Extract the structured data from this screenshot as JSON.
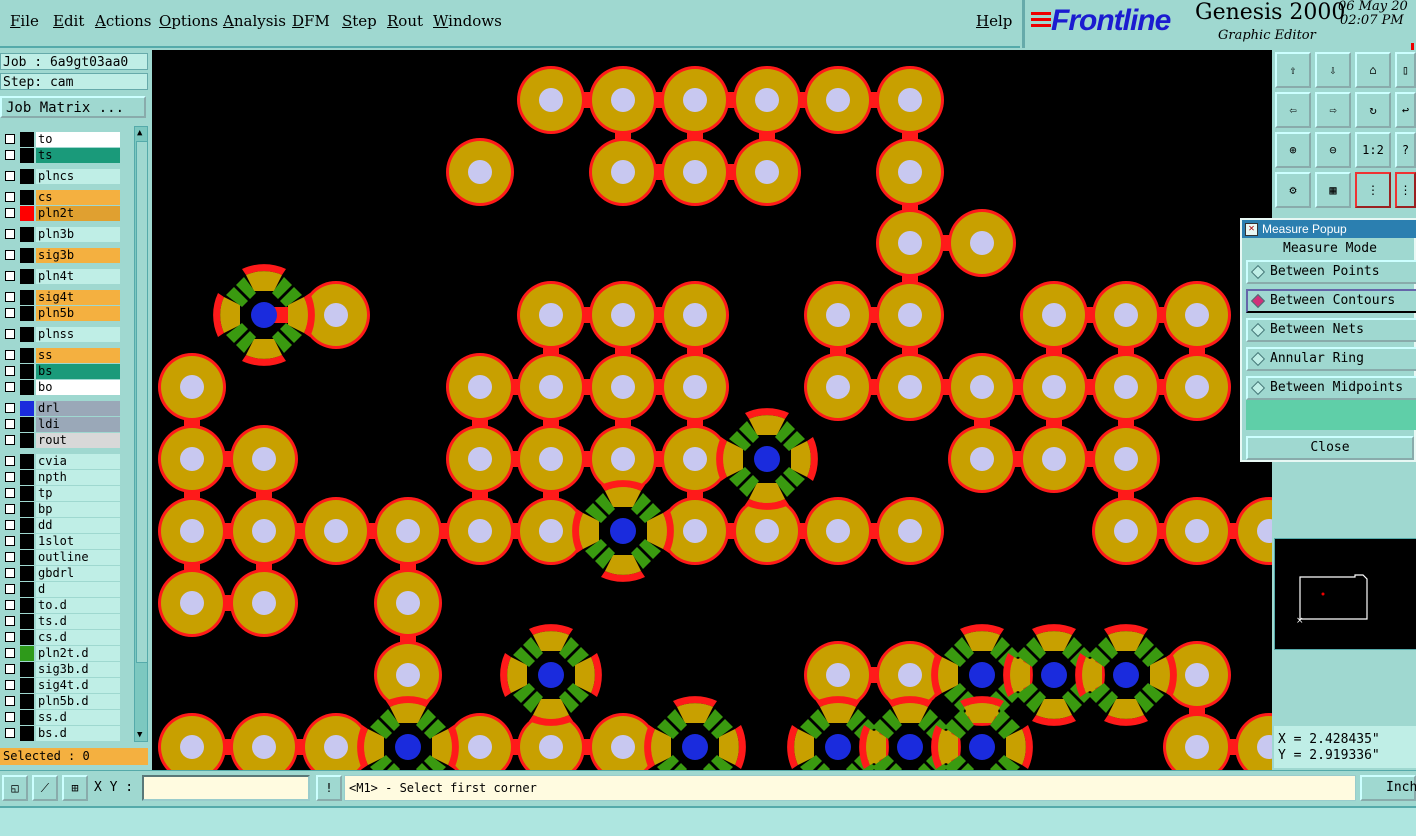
{
  "menu": {
    "items": [
      "File",
      "Edit",
      "Actions",
      "Options",
      "Analysis",
      "DFM",
      "Step",
      "Rout",
      "Windows"
    ],
    "help": "Help"
  },
  "brand": {
    "logo": "Frontline",
    "product": "Genesis 2000",
    "subtitle": "Graphic Editor",
    "date": "06 May 20",
    "time": "02:07 PM"
  },
  "left": {
    "job": "Job : 6a9gt03aa0",
    "step": "Step: cam",
    "job_matrix": "Job Matrix ...",
    "selected": "Selected : 0"
  },
  "layers": [
    {
      "name": "to",
      "bg": "#ffffff",
      "swatch": "#000000"
    },
    {
      "name": "ts",
      "bg": "#1a9a7a",
      "swatch": "#000000"
    },
    {
      "name": "plncs",
      "bg": "#bfeee6",
      "swatch": "#000000"
    },
    {
      "name": "cs",
      "bg": "#f4b040",
      "swatch": "#000000"
    },
    {
      "name": "pln2t",
      "bg": "#e0a030",
      "swatch": "#ff0000"
    },
    {
      "name": "pln3b",
      "bg": "#bfeee6",
      "swatch": "#000000"
    },
    {
      "name": "sig3b",
      "bg": "#f4b040",
      "swatch": "#000000"
    },
    {
      "name": "pln4t",
      "bg": "#bfeee6",
      "swatch": "#000000"
    },
    {
      "name": "sig4t",
      "bg": "#f4b040",
      "swatch": "#000000"
    },
    {
      "name": "pln5b",
      "bg": "#f4b040",
      "swatch": "#000000"
    },
    {
      "name": "plnss",
      "bg": "#bfeee6",
      "swatch": "#000000"
    },
    {
      "name": "ss",
      "bg": "#f4b040",
      "swatch": "#000000"
    },
    {
      "name": "bs",
      "bg": "#1a9a7a",
      "swatch": "#000000"
    },
    {
      "name": "bo",
      "bg": "#ffffff",
      "swatch": "#000000"
    },
    {
      "name": "drl",
      "bg": "#9aa8b8",
      "swatch": "#1a2bdd"
    },
    {
      "name": "ldi",
      "bg": "#9aa8b8",
      "swatch": "#000000"
    },
    {
      "name": "rout",
      "bg": "#d8d8d8",
      "swatch": "#000000"
    },
    {
      "name": "cvia",
      "bg": "#bfeee6",
      "swatch": "#000000"
    },
    {
      "name": "npth",
      "bg": "#bfeee6",
      "swatch": "#000000"
    },
    {
      "name": "tp",
      "bg": "#bfeee6",
      "swatch": "#000000"
    },
    {
      "name": "bp",
      "bg": "#bfeee6",
      "swatch": "#000000"
    },
    {
      "name": "dd",
      "bg": "#bfeee6",
      "swatch": "#000000"
    },
    {
      "name": "1slot",
      "bg": "#bfeee6",
      "swatch": "#000000"
    },
    {
      "name": "outline",
      "bg": "#bfeee6",
      "swatch": "#000000"
    },
    {
      "name": "gbdrl",
      "bg": "#bfeee6",
      "swatch": "#000000"
    },
    {
      "name": "d",
      "bg": "#bfeee6",
      "swatch": "#000000"
    },
    {
      "name": "to.d",
      "bg": "#bfeee6",
      "swatch": "#000000"
    },
    {
      "name": "ts.d",
      "bg": "#bfeee6",
      "swatch": "#000000"
    },
    {
      "name": "cs.d",
      "bg": "#bfeee6",
      "swatch": "#000000"
    },
    {
      "name": "pln2t.d",
      "bg": "#bfeee6",
      "swatch": "#2e9a1a"
    },
    {
      "name": "sig3b.d",
      "bg": "#bfeee6",
      "swatch": "#000000"
    },
    {
      "name": "sig4t.d",
      "bg": "#bfeee6",
      "swatch": "#000000"
    },
    {
      "name": "pln5b.d",
      "bg": "#bfeee6",
      "swatch": "#000000"
    },
    {
      "name": "ss.d",
      "bg": "#bfeee6",
      "swatch": "#000000"
    },
    {
      "name": "bs.d",
      "bg": "#bfeee6",
      "swatch": "#000000"
    }
  ],
  "toolbar": {
    "ratio_label": "1:2"
  },
  "measure": {
    "title": "Measure Popup",
    "mode_label": "Measure Mode",
    "options": [
      "Between Points",
      "Between Contours",
      "Between Nets",
      "Annular Ring",
      "Between Midpoints"
    ],
    "selected_option": "Between Contours",
    "close": "Close"
  },
  "coords": {
    "x": "X = 2.428435\"",
    "y": "Y = 2.919336\""
  },
  "command": {
    "xy_label": "X Y :",
    "xy_value": "",
    "message": "<M1> - Select first corner",
    "unit": "Inch"
  },
  "colors": {
    "pad_fill": "#c8a000",
    "pad_hole": "#c8c8f0",
    "pad_outline": "#ff1a1a",
    "via_center": "#1a2bdd",
    "via_green": "#3a9a10",
    "canvas_bg": "#000000"
  }
}
